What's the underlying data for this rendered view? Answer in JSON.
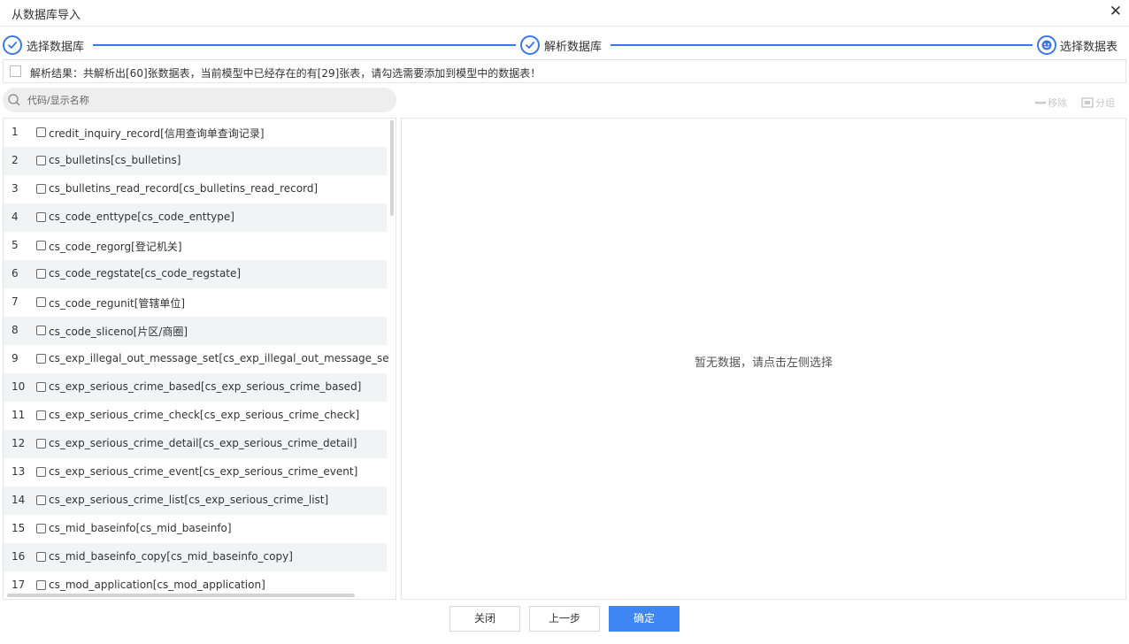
{
  "dialog": {
    "title": "从数据库导入",
    "close_icon": "close-icon"
  },
  "steps": [
    {
      "label": "选择数据库",
      "state": "done"
    },
    {
      "label": "解析数据库",
      "state": "done"
    },
    {
      "label": "选择数据表",
      "state": "current"
    }
  ],
  "result": {
    "text": "解析结果：共解析出[60]张数据表，当前模型中已经存在的有[29]张表，请勾选需要添加到模型中的数据表！"
  },
  "search": {
    "placeholder": "代码/显示名称",
    "value": ""
  },
  "toolbar": {
    "remove_label": "移除",
    "group_label": "分组"
  },
  "tables": [
    {
      "num": "1",
      "name": "credit_inquiry_record[信用查询单查询记录]"
    },
    {
      "num": "2",
      "name": "cs_bulletins[cs_bulletins]"
    },
    {
      "num": "3",
      "name": "cs_bulletins_read_record[cs_bulletins_read_record]"
    },
    {
      "num": "4",
      "name": "cs_code_enttype[cs_code_enttype]"
    },
    {
      "num": "5",
      "name": "cs_code_regorg[登记机关]"
    },
    {
      "num": "6",
      "name": "cs_code_regstate[cs_code_regstate]"
    },
    {
      "num": "7",
      "name": "cs_code_regunit[管辖单位]"
    },
    {
      "num": "8",
      "name": "cs_code_sliceno[片区/商圈]"
    },
    {
      "num": "9",
      "name": "cs_exp_illegal_out_message_set[cs_exp_illegal_out_message_se"
    },
    {
      "num": "10",
      "name": "cs_exp_serious_crime_based[cs_exp_serious_crime_based]"
    },
    {
      "num": "11",
      "name": "cs_exp_serious_crime_check[cs_exp_serious_crime_check]"
    },
    {
      "num": "12",
      "name": "cs_exp_serious_crime_detail[cs_exp_serious_crime_detail]"
    },
    {
      "num": "13",
      "name": "cs_exp_serious_crime_event[cs_exp_serious_crime_event]"
    },
    {
      "num": "14",
      "name": "cs_exp_serious_crime_list[cs_exp_serious_crime_list]"
    },
    {
      "num": "15",
      "name": "cs_mid_baseinfo[cs_mid_baseinfo]"
    },
    {
      "num": "16",
      "name": "cs_mid_baseinfo_copy[cs_mid_baseinfo_copy]"
    },
    {
      "num": "17",
      "name": "cs_mod_application[cs_mod_application]"
    }
  ],
  "right_panel": {
    "empty_text": "暂无数据，请点击左侧选择"
  },
  "footer": {
    "close_label": "关闭",
    "prev_label": "上一步",
    "confirm_label": "确定"
  },
  "colors": {
    "accent": "#3a78e6",
    "primary_button": "#3f86f5",
    "alt_row": "#f2f3f5"
  }
}
